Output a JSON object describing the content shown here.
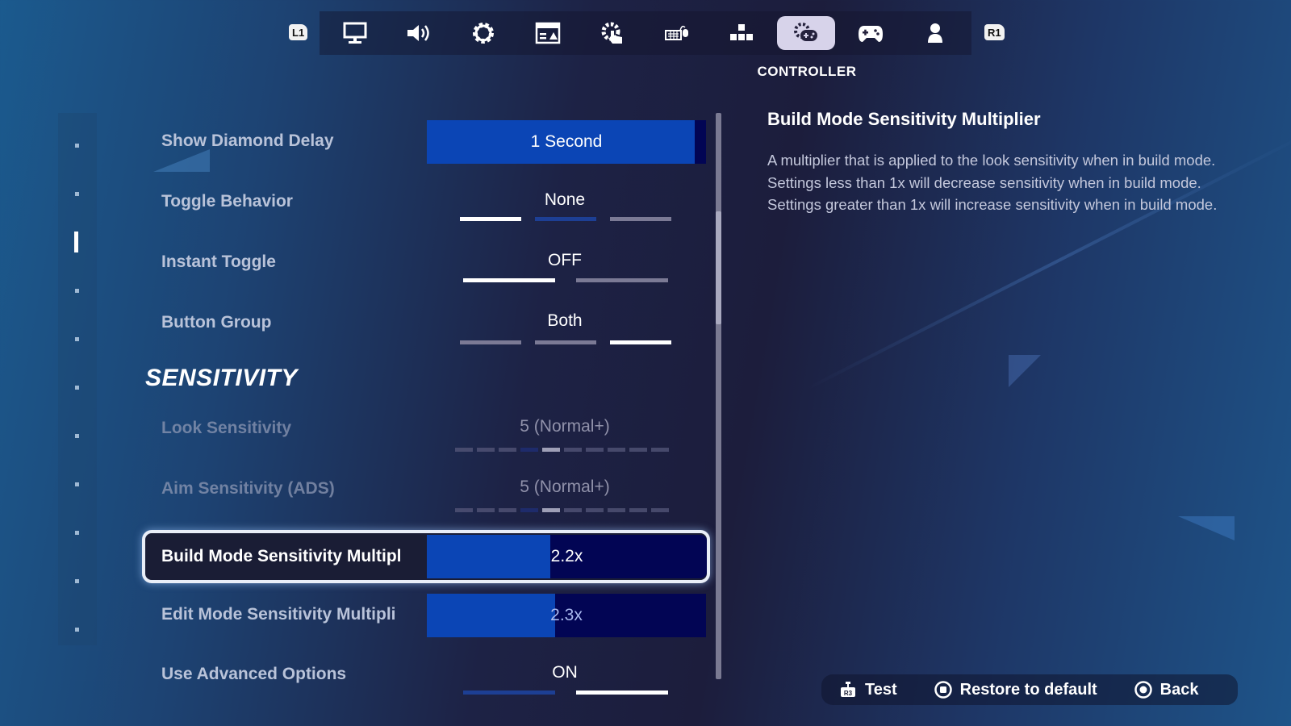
{
  "top_nav": {
    "left_bumper": "L1",
    "right_bumper": "R1",
    "tabs": [
      {
        "icon": "monitor-icon",
        "active": false
      },
      {
        "icon": "speaker-icon",
        "active": false
      },
      {
        "icon": "gear-icon",
        "active": false
      },
      {
        "icon": "hud-layout-icon",
        "active": false
      },
      {
        "icon": "touch-gear-icon",
        "active": false
      },
      {
        "icon": "keyboard-mouse-icon",
        "active": false
      },
      {
        "icon": "arrow-keys-icon",
        "active": false
      },
      {
        "icon": "controller-gear-icon",
        "active": true
      },
      {
        "icon": "gamepad-icon",
        "active": false
      },
      {
        "icon": "account-icon",
        "active": false
      }
    ],
    "active_tab_caption": "CONTROLLER"
  },
  "settings": {
    "show_diamond_delay": {
      "label": "Show Diamond Delay",
      "value": "1 Second"
    },
    "toggle_behavior": {
      "label": "Toggle Behavior",
      "value": "None",
      "options_count": 3,
      "selected_index": 0
    },
    "instant_toggle": {
      "label": "Instant Toggle",
      "value": "OFF",
      "options_count": 2,
      "selected_index": 0
    },
    "button_group": {
      "label": "Button Group",
      "value": "Both",
      "options_count": 3,
      "selected_index": 2
    },
    "section_sensitivity": "SENSITIVITY",
    "look_sensitivity": {
      "label": "Look Sensitivity",
      "value": "5 (Normal+)",
      "level": 5,
      "max": 10
    },
    "aim_sensitivity": {
      "label": "Aim Sensitivity (ADS)",
      "value": "5 (Normal+)",
      "level": 5,
      "max": 10
    },
    "build_mode_multiplier": {
      "label": "Build Mode Sensitivity Multipl",
      "value": "2.2x",
      "fill_fraction": 0.44
    },
    "edit_mode_multiplier": {
      "label": "Edit Mode Sensitivity Multipli",
      "value": "2.3x",
      "fill_fraction": 0.46
    },
    "use_advanced_options": {
      "label": "Use Advanced Options",
      "value": "ON",
      "options_count": 2,
      "selected_index": 1
    }
  },
  "description": {
    "title": "Build Mode Sensitivity Multiplier",
    "body": "A multiplier that is applied to the look sensitivity when in build mode.  Settings less than 1x will decrease sensitivity when in build mode.  Settings greater than 1x will increase sensitivity when in build mode."
  },
  "footer": {
    "test": "Test",
    "restore": "Restore to default",
    "back": "Back"
  },
  "colors": {
    "accent_blue": "#0b45b5",
    "value_bg": "#020554",
    "active_tab_bg": "#d7d3ea"
  }
}
